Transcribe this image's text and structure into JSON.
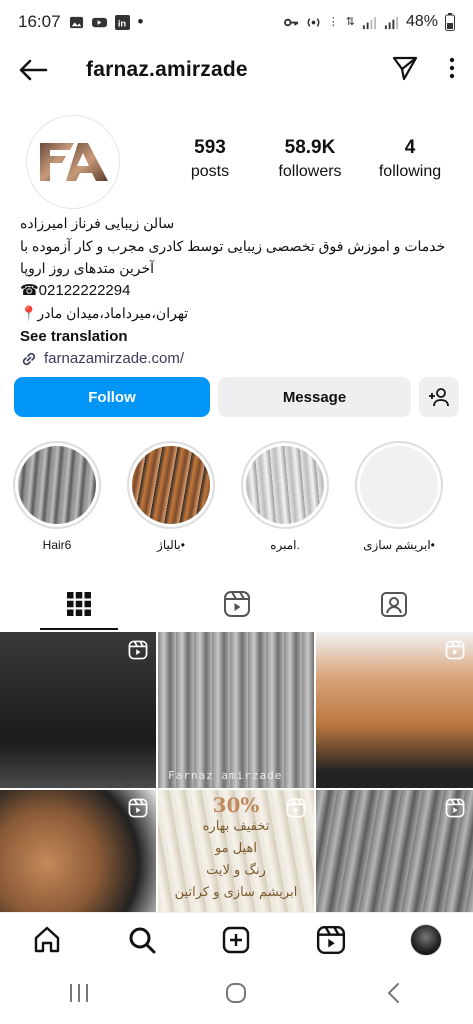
{
  "status_bar": {
    "time": "16:07",
    "battery": "48%",
    "dot": "•"
  },
  "header": {
    "username": "farnaz.amirzade"
  },
  "profile": {
    "stats": [
      {
        "value": "593",
        "label": "posts"
      },
      {
        "value": "58.9K",
        "label": "followers"
      },
      {
        "value": "4",
        "label": "following"
      }
    ]
  },
  "bio": {
    "line1": "سالن زیبایی فرناز امیرزاده",
    "line2": "خدمات و اموزش فوق تخصصی زیبایی توسط کادری مجرب و کار آزموده با",
    "line3": "آخرین متدهای روز اروپا",
    "phone": "☎02122222294",
    "address": "تهران،میرداماد،میدان مادر📍",
    "see_translation": "See translation",
    "link": "farnazamirzade.com/"
  },
  "actions": {
    "follow": "Follow",
    "message": "Message"
  },
  "highlights": [
    {
      "label": "Hair6",
      "color_a": "#9a9a9a",
      "color_b": "#5c5c5c"
    },
    {
      "label": "•بالیاژ",
      "color_a": "#c4773a",
      "color_b": "#2b2b2b"
    },
    {
      "label": ".امبره",
      "color_a": "#e0e0e0",
      "color_b": "#9b9b9b"
    },
    {
      "label": "•ابریشم سازی",
      "color_a": "#f1f1f1",
      "color_b": "#eaeaea"
    }
  ],
  "grid": {
    "promo": {
      "percent": "30%",
      "line1": "تخفیف بهاره",
      "line2": "اهیل مو",
      "line3": "رنگ و لایت",
      "line4": "ابریشم سازی و کراتین"
    },
    "watermark": "Farnaz amirzade"
  },
  "colors": {
    "accent": "#0095f6",
    "secondary_button": "#efeff2"
  }
}
